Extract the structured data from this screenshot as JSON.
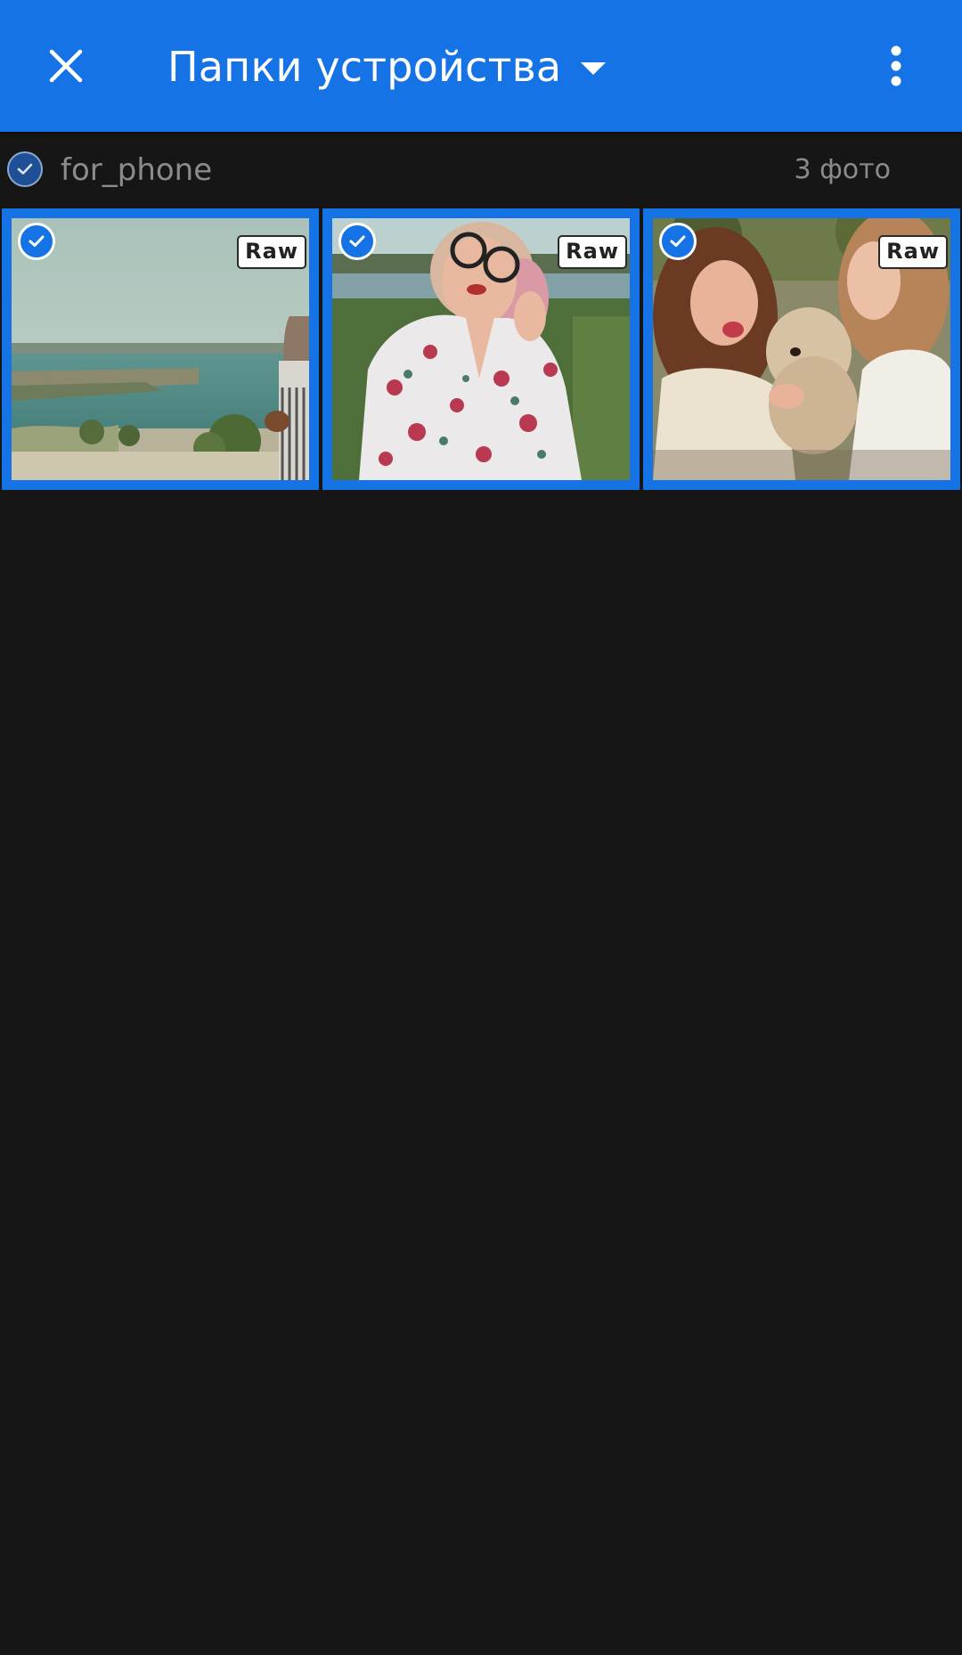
{
  "appbar": {
    "title": "Папки устройства",
    "background_color": "#1673e6",
    "close_icon": "close-icon",
    "dropdown_icon": "caret-down-icon",
    "more_icon": "more-vertical-icon"
  },
  "folder": {
    "name": "for_phone",
    "count_label": "3 фото",
    "selected": true
  },
  "photos": [
    {
      "subject": "river embankment with woman",
      "badge": "Raw",
      "selected": true
    },
    {
      "subject": "woman in floral blouse and glasses",
      "badge": "Raw",
      "selected": true
    },
    {
      "subject": "two women with curly dog",
      "badge": "Raw",
      "selected": true
    }
  ],
  "colors": {
    "accent": "#1673e6",
    "background": "#161616",
    "muted_text": "#8b8b8b"
  }
}
